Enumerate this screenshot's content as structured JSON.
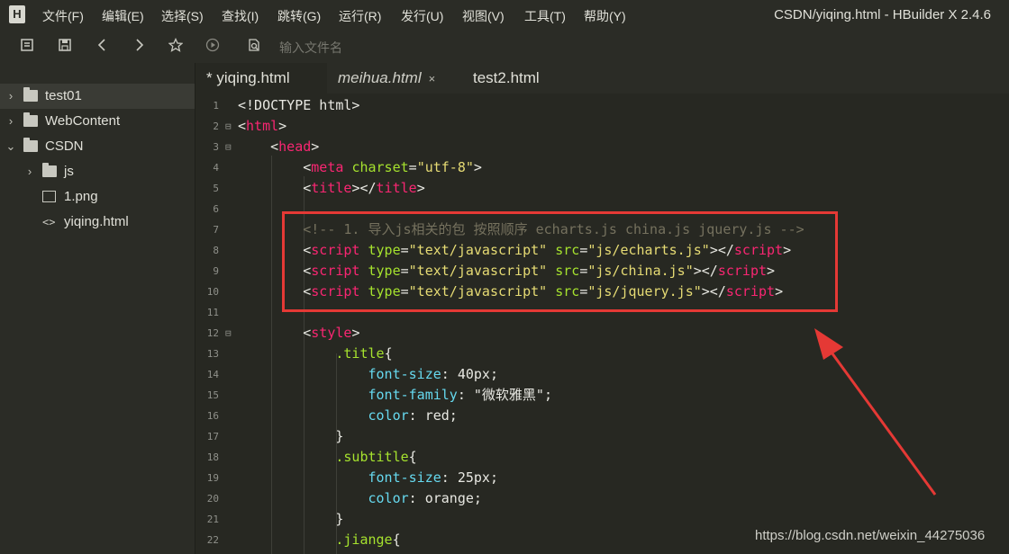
{
  "app": {
    "logo": "H",
    "window_title": "CSDN/yiqing.html - HBuilder X 2.4.6"
  },
  "menu": [
    "文件(F)",
    "编辑(E)",
    "选择(S)",
    "查找(I)",
    "跳转(G)",
    "运行(R)",
    "发行(U)",
    "视图(V)",
    "工具(T)",
    "帮助(Y)"
  ],
  "toolbar": {
    "icons": [
      "new-file-icon",
      "save-icon",
      "back-icon",
      "forward-icon",
      "star-icon",
      "run-icon",
      "search-file-icon"
    ],
    "search_placeholder": "输入文件名"
  },
  "sidebar": {
    "items": [
      {
        "label": "test01",
        "icon": "folder-icon",
        "chevron": "›",
        "selected": true
      },
      {
        "label": "WebContent",
        "icon": "folder-icon",
        "chevron": "›",
        "selected": false
      },
      {
        "label": "CSDN",
        "icon": "folder-icon",
        "chevron": "⌄",
        "selected": false
      },
      {
        "label": "js",
        "icon": "folder-icon",
        "chevron": "›",
        "selected": false
      },
      {
        "label": "1.png",
        "icon": "image-icon",
        "chevron": "",
        "selected": false
      },
      {
        "label": "yiqing.html",
        "icon": "code-icon",
        "chevron": "",
        "selected": false
      }
    ]
  },
  "tabs": [
    {
      "label": "* yiqing.html",
      "active": true,
      "italic": false,
      "close": ""
    },
    {
      "label": "meihua.html",
      "active": false,
      "italic": true,
      "close": "×"
    },
    {
      "label": "test2.html",
      "active": false,
      "italic": false,
      "close": ""
    }
  ],
  "editor": {
    "lines": [
      {
        "n": "1",
        "fold": "",
        "tokens": [
          [
            "br",
            "<!DOCTYPE html>"
          ]
        ]
      },
      {
        "n": "2",
        "fold": "⊟",
        "tokens": [
          [
            "br",
            "<"
          ],
          [
            "tag",
            "html"
          ],
          [
            "br",
            ">"
          ]
        ]
      },
      {
        "n": "3",
        "fold": "⊟",
        "tokens": [
          [
            "txt",
            "    "
          ],
          [
            "br",
            "<"
          ],
          [
            "tag",
            "head"
          ],
          [
            "br",
            ">"
          ]
        ]
      },
      {
        "n": "4",
        "fold": "",
        "tokens": [
          [
            "txt",
            "        "
          ],
          [
            "br",
            "<"
          ],
          [
            "tag",
            "meta"
          ],
          [
            "txt",
            " "
          ],
          [
            "attr",
            "charset"
          ],
          [
            "br",
            "="
          ],
          [
            "str",
            "\"utf-8\""
          ],
          [
            "br",
            ">"
          ]
        ]
      },
      {
        "n": "5",
        "fold": "",
        "tokens": [
          [
            "txt",
            "        "
          ],
          [
            "br",
            "<"
          ],
          [
            "tag",
            "title"
          ],
          [
            "br",
            "></"
          ],
          [
            "tag",
            "title"
          ],
          [
            "br",
            ">"
          ]
        ]
      },
      {
        "n": "6",
        "fold": "",
        "tokens": []
      },
      {
        "n": "7",
        "fold": "",
        "tokens": [
          [
            "txt",
            "        "
          ],
          [
            "com",
            "<!-- 1. 导入js相关的包 按照顺序 echarts.js china.js jquery.js -->"
          ]
        ]
      },
      {
        "n": "8",
        "fold": "",
        "tokens": [
          [
            "txt",
            "        "
          ],
          [
            "br",
            "<"
          ],
          [
            "tag",
            "script"
          ],
          [
            "txt",
            " "
          ],
          [
            "attr",
            "type"
          ],
          [
            "br",
            "="
          ],
          [
            "str",
            "\"text/javascript\""
          ],
          [
            "txt",
            " "
          ],
          [
            "attr",
            "src"
          ],
          [
            "br",
            "="
          ],
          [
            "str",
            "\"js/echarts.js\""
          ],
          [
            "br",
            "></"
          ],
          [
            "tag",
            "script"
          ],
          [
            "br",
            ">"
          ]
        ]
      },
      {
        "n": "9",
        "fold": "",
        "tokens": [
          [
            "txt",
            "        "
          ],
          [
            "br",
            "<"
          ],
          [
            "tag",
            "script"
          ],
          [
            "txt",
            " "
          ],
          [
            "attr",
            "type"
          ],
          [
            "br",
            "="
          ],
          [
            "str",
            "\"text/javascript\""
          ],
          [
            "txt",
            " "
          ],
          [
            "attr",
            "src"
          ],
          [
            "br",
            "="
          ],
          [
            "str",
            "\"js/china.js\""
          ],
          [
            "br",
            "></"
          ],
          [
            "tag",
            "script"
          ],
          [
            "br",
            ">"
          ]
        ]
      },
      {
        "n": "10",
        "fold": "",
        "tokens": [
          [
            "txt",
            "        "
          ],
          [
            "br",
            "<"
          ],
          [
            "tag",
            "script"
          ],
          [
            "txt",
            " "
          ],
          [
            "attr",
            "type"
          ],
          [
            "br",
            "="
          ],
          [
            "str",
            "\"text/javascript\""
          ],
          [
            "txt",
            " "
          ],
          [
            "attr",
            "src"
          ],
          [
            "br",
            "="
          ],
          [
            "str",
            "\"js/jquery.js\""
          ],
          [
            "br",
            "></"
          ],
          [
            "tag",
            "script"
          ],
          [
            "br",
            ">"
          ]
        ]
      },
      {
        "n": "11",
        "fold": "",
        "tokens": []
      },
      {
        "n": "12",
        "fold": "⊟",
        "tokens": [
          [
            "txt",
            "        "
          ],
          [
            "br",
            "<"
          ],
          [
            "tag",
            "style"
          ],
          [
            "br",
            ">"
          ]
        ]
      },
      {
        "n": "13",
        "fold": "",
        "tokens": [
          [
            "txt",
            "            "
          ],
          [
            "sel",
            ".title"
          ],
          [
            "br",
            "{"
          ]
        ]
      },
      {
        "n": "14",
        "fold": "",
        "tokens": [
          [
            "txt",
            "                "
          ],
          [
            "prop",
            "font-size"
          ],
          [
            "br",
            ": "
          ],
          [
            "txt",
            "40px;"
          ]
        ]
      },
      {
        "n": "15",
        "fold": "",
        "tokens": [
          [
            "txt",
            "                "
          ],
          [
            "prop",
            "font-family"
          ],
          [
            "br",
            ": "
          ],
          [
            "txt",
            "\"微软雅黑\";"
          ]
        ]
      },
      {
        "n": "16",
        "fold": "",
        "tokens": [
          [
            "txt",
            "                "
          ],
          [
            "prop",
            "color"
          ],
          [
            "br",
            ": "
          ],
          [
            "txt",
            "red;"
          ]
        ]
      },
      {
        "n": "17",
        "fold": "",
        "tokens": [
          [
            "txt",
            "            "
          ],
          [
            "br",
            "}"
          ]
        ]
      },
      {
        "n": "18",
        "fold": "",
        "tokens": [
          [
            "txt",
            "            "
          ],
          [
            "sel",
            ".subtitle"
          ],
          [
            "br",
            "{"
          ]
        ]
      },
      {
        "n": "19",
        "fold": "",
        "tokens": [
          [
            "txt",
            "                "
          ],
          [
            "prop",
            "font-size"
          ],
          [
            "br",
            ": "
          ],
          [
            "txt",
            "25px;"
          ]
        ]
      },
      {
        "n": "20",
        "fold": "",
        "tokens": [
          [
            "txt",
            "                "
          ],
          [
            "prop",
            "color"
          ],
          [
            "br",
            ": "
          ],
          [
            "txt",
            "orange;"
          ]
        ]
      },
      {
        "n": "21",
        "fold": "",
        "tokens": [
          [
            "txt",
            "            "
          ],
          [
            "br",
            "}"
          ]
        ]
      },
      {
        "n": "22",
        "fold": "",
        "tokens": [
          [
            "txt",
            "            "
          ],
          [
            "sel",
            ".jiange"
          ],
          [
            "br",
            "{"
          ]
        ]
      }
    ]
  },
  "annotation": {
    "box_color": "#e53935",
    "arrow_color": "#e53935"
  },
  "watermark": "https://blog.csdn.net/weixin_44275036"
}
